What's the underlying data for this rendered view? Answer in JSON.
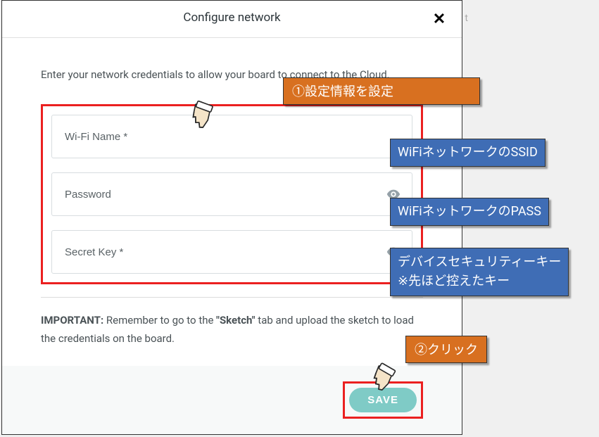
{
  "modal": {
    "title": "Configure network",
    "intro": "Enter your network credentials to allow your board to connect to the Cloud.",
    "important_label": "IMPORTANT:",
    "important_text_1": " Remember to go to the ",
    "important_sketch": "\"Sketch\"",
    "important_text_2": " tab and upload the sketch to load the credentials on the board.",
    "save_label": "SAVE"
  },
  "inputs": {
    "wifi_placeholder": "Wi-Fi Name *",
    "password_placeholder": "Password",
    "secret_placeholder": "Secret Key *"
  },
  "annotations": {
    "step1": "①設定情報を設定",
    "ssid": "WiFiネットワークのSSID",
    "pass": "WiFiネットワークのPASS",
    "secret_l1": "デバイスセキュリティーキー",
    "secret_l2": "※先ほど控えたキー",
    "step2": "②クリック"
  }
}
